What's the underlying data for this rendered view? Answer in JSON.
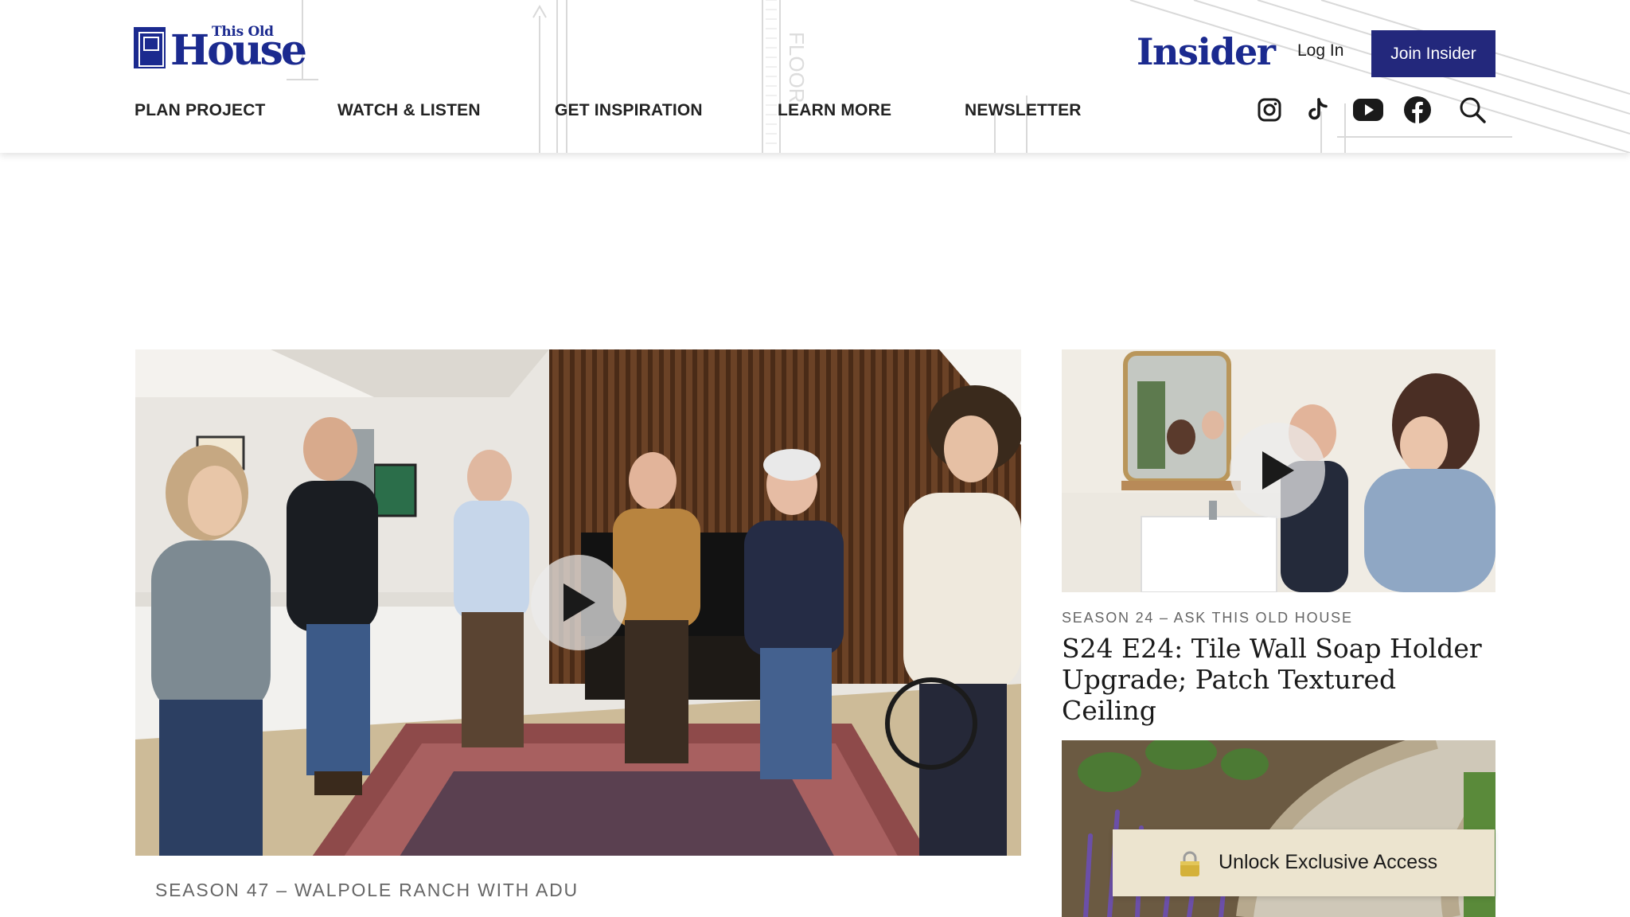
{
  "header": {
    "logo": {
      "line1": "This Old",
      "line2": "House"
    },
    "insider_label": "Insider",
    "login_label": "Log In",
    "join_label": "Join Insider",
    "nav": [
      {
        "label": "PLAN PROJECT"
      },
      {
        "label": "WATCH & LISTEN"
      },
      {
        "label": "GET INSPIRATION"
      },
      {
        "label": "LEARN MORE"
      },
      {
        "label": "NEWSLETTER"
      }
    ],
    "social_icons": [
      "instagram-icon",
      "tiktok-icon",
      "youtube-icon",
      "facebook-icon",
      "search-icon"
    ],
    "blueprint_text": "FLOOR"
  },
  "featured": {
    "eyebrow": "SEASON 47 – WALPOLE RANCH WITH ADU",
    "image_description": "Group of people standing in a living room with slatted wood wall and patterned rug"
  },
  "side_card": {
    "eyebrow": "SEASON 24 – ASK THIS OLD HOUSE",
    "title": "S24 E24: Tile Wall Soap Holder Upgrade; Patch Textured Ceiling"
  },
  "unlock": {
    "label": "Unlock Exclusive Access"
  },
  "colors": {
    "brand_blue": "#1b2a8f",
    "join_button": "#23287c",
    "unlock_bg": "#ece4cf",
    "eyebrow_gray": "#666666"
  }
}
